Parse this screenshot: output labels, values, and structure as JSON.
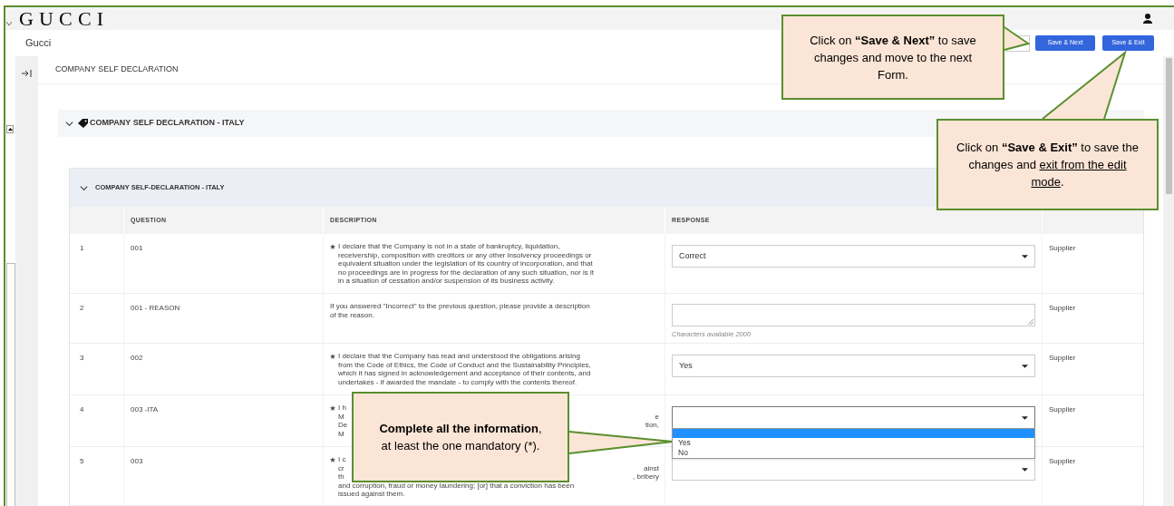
{
  "header": {
    "logo": "GUCCI"
  },
  "breadcrumb": "Gucci",
  "buttons": [
    {
      "label": "Save & Next"
    },
    {
      "label": "Save & Exit"
    }
  ],
  "page_title": "COMPANY SELF DECLARATION",
  "section": {
    "title": "COMPANY SELF DECLARATION - ITALY",
    "expanded": true
  },
  "subsection": {
    "title": "COMPANY SELF-DECLARATION - ITALY",
    "expanded": true
  },
  "table": {
    "columns": [
      "QUESTION",
      "DESCRIPTION",
      "RESPONSE"
    ],
    "rows": [
      {
        "number": "1",
        "question": "001",
        "mandatory": true,
        "description": [
          "I declare that the Company is not in a state of bankruptcy, liquidation,",
          "receivership, composition with creditors or any other insolvency proceedings or",
          "equivalent situation under the legislation of its country of incorporation, and that",
          "no proceedings are in progress for the declaration of any such situation, nor is it",
          "in a situation of cessation and/or suspension of its business activity."
        ],
        "response": {
          "kind": "select",
          "value": "Correct"
        },
        "owner": "Supplier"
      },
      {
        "number": "2",
        "question": "001 - REASON",
        "mandatory": false,
        "description": [
          "If you answered \"Incorrect\" to the previous question, please provide a description",
          "of the reason."
        ],
        "response": {
          "kind": "textarea",
          "note": "Characters available 2000"
        },
        "owner": "Supplier"
      },
      {
        "number": "3",
        "question": "002",
        "mandatory": true,
        "description": [
          "I declare that the Company has read and understood the obligations arising",
          "from the Code of Ethics, the Code of Conduct and the Sustainability Principles,",
          "which it has signed in acknowledgement and acceptance of their contents, and",
          "undertakes - if awarded the mandate - to comply with the contents thereof."
        ],
        "response": {
          "kind": "select",
          "value": "Yes"
        },
        "owner": "Supplier"
      },
      {
        "number": "4",
        "question": "003 -ITA",
        "mandatory": true,
        "description": [
          "I h",
          {
            "left": "M",
            "right": "e"
          },
          {
            "left": "De",
            "right": "tion,"
          },
          "M"
        ],
        "response": {
          "kind": "select",
          "open": true,
          "blank_highlighted": true,
          "options": [
            {
              "label": "Yes",
              "selected": false
            },
            {
              "label": "No",
              "selected": false
            }
          ]
        },
        "owner": "Supplier"
      },
      {
        "number": "5",
        "question": "003",
        "mandatory": true,
        "description": [
          "I c",
          {
            "left": "cr",
            "right": "ainst"
          },
          {
            "left": "th",
            "right": ", bribery"
          },
          "and corruption, fraud or money laundering; [or] that a conviction has been",
          "issued against them."
        ],
        "response": {
          "kind": "select"
        },
        "owner": "Supplier"
      }
    ]
  },
  "callouts": [
    {
      "segments": [
        {
          "text": "Click on **“Save & Next”** to save changes and move to the next Form.",
          "underline": false
        }
      ]
    },
    {
      "segments": [
        {
          "text": "Click on **“Save & Exit”** to save the changes and ",
          "underline": false
        },
        {
          "text": "exit from the edit mode",
          "underline": true
        },
        {
          "text": ".",
          "underline": false
        }
      ]
    },
    {
      "segments": [
        {
          "text": "**Complete all the information**, at least the one mandatory (*).",
          "underline": false
        }
      ]
    }
  ]
}
